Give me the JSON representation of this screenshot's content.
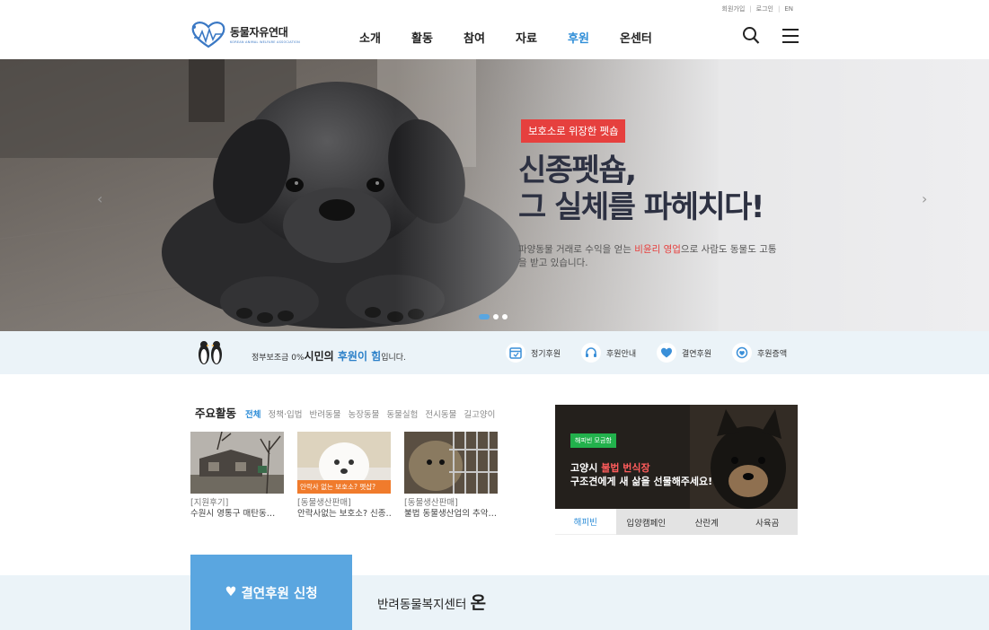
{
  "util": {
    "join": "회원가입",
    "login": "로그인",
    "lang": "EN"
  },
  "logo": {
    "name": "동물자유연대",
    "sub": "KOREAN ANIMAL WELFARE ASSOCIATION"
  },
  "nav": [
    {
      "label": "소개",
      "active": false
    },
    {
      "label": "활동",
      "active": false
    },
    {
      "label": "참여",
      "active": false
    },
    {
      "label": "자료",
      "active": false
    },
    {
      "label": "후원",
      "active": true
    },
    {
      "label": "온센터",
      "active": false
    }
  ],
  "hero": {
    "badge": "보호소로 위장한 펫숍",
    "title": "신종펫숍,\n그 실체를 파헤치다!",
    "desc_pre": "파양동물 거래로 수익을 얻는 ",
    "desc_hl": "비윤리 영업",
    "desc_post": "으로 사람도 동물도 고통을 받고 있습니다.",
    "slides": 3,
    "active_slide": 0
  },
  "band": {
    "pre": "정부보조금 0%",
    "mid": "시민의 ",
    "hand": "후원이 힘",
    "post": "입니다.",
    "links": [
      {
        "label": "정기후원",
        "icon": "calendar-icon"
      },
      {
        "label": "후원안내",
        "icon": "headset-icon"
      },
      {
        "label": "결연후원",
        "icon": "heart-icon"
      },
      {
        "label": "후원증액",
        "icon": "coin-icon"
      }
    ]
  },
  "activities": {
    "title": "주요활동",
    "tabs": [
      {
        "label": "전체",
        "active": true
      },
      {
        "label": "정책·입법",
        "active": false
      },
      {
        "label": "반려동물",
        "active": false
      },
      {
        "label": "농장동물",
        "active": false
      },
      {
        "label": "동물실험",
        "active": false
      },
      {
        "label": "전시동물",
        "active": false
      },
      {
        "label": "길고양이",
        "active": false
      }
    ],
    "items": [
      {
        "category": "[지원후기]",
        "title": "수원시 영통구 매탄동…",
        "overlay": ""
      },
      {
        "category": "[동물생산판매]",
        "title": "안락사없는 보호소? 신종…",
        "overlay": "안락사 없는 보호소? 펫샵?"
      },
      {
        "category": "[동물생산판매]",
        "title": "불법 동물생산업의 추악…",
        "overlay": ""
      }
    ]
  },
  "happybean": {
    "tag": "해피빈 모금함",
    "line1_pre": "고양시 ",
    "line1_red": "불법 번식장",
    "line2": "구조견에게 새 삶을 선물해주세요!",
    "tabs": [
      {
        "label": "해피빈",
        "active": true
      },
      {
        "label": "입양캠페인",
        "active": false
      },
      {
        "label": "산란계",
        "active": false
      },
      {
        "label": "사육곰",
        "active": false
      }
    ]
  },
  "bottom": {
    "apply": "결연후원 신청",
    "center_pre": "반려동물복지센터 ",
    "center_big": "온"
  },
  "colors": {
    "accent": "#2f8ed8",
    "red": "#e6403e",
    "band": "#ebf3f8",
    "apply": "#5aa6e0"
  }
}
